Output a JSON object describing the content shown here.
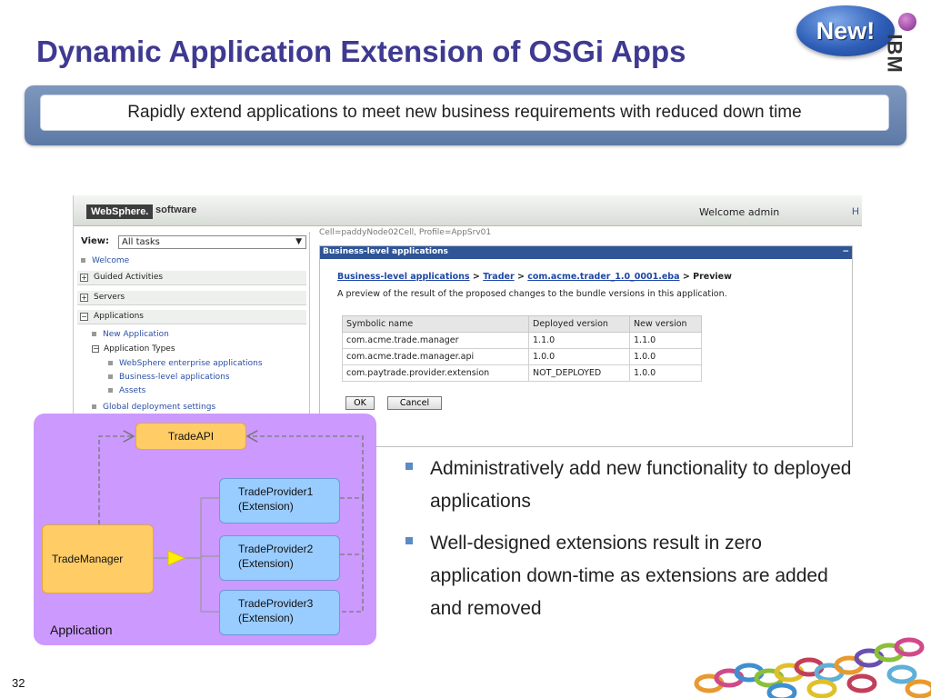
{
  "slide": {
    "title": "Dynamic Application Extension of OSGi Apps",
    "badge": "New!",
    "logo_text": "IBM",
    "banner_text": "Rapidly extend applications to meet new business requirements with reduced down time",
    "page_number": "32"
  },
  "console": {
    "brand": "WebSphere.",
    "brand_suffix": "software",
    "welcome": "Welcome admin",
    "header_trunc": "H",
    "view_label": "View:",
    "view_value": "All tasks",
    "nav": {
      "welcome": "Welcome",
      "guided": "Guided Activities",
      "servers": "Servers",
      "applications": "Applications",
      "new_application": "New Application",
      "application_types": "Application Types",
      "websphere_apps": "WebSphere enterprise applications",
      "bla": "Business-level applications",
      "assets": "Assets",
      "global_deploy": "Global deployment settings"
    },
    "cell_info": "Cell=paddyNode02Cell, Profile=AppSrv01",
    "panel_title": "Business-level applications",
    "panel_min": "−",
    "breadcrumb": {
      "link1": "Business-level applications",
      "link2": "Trader",
      "link3": "com.acme.trader_1.0_0001.eba",
      "sep": ">",
      "current": "Preview"
    },
    "preview_desc": "A preview of the result of the proposed changes to the bundle versions in this application.",
    "table": {
      "headers": [
        "Symbolic name",
        "Deployed version",
        "New version"
      ],
      "rows": [
        [
          "com.acme.trade.manager",
          "1.1.0",
          "1.1.0"
        ],
        [
          "com.acme.trade.manager.api",
          "1.0.0",
          "1.0.0"
        ],
        [
          "com.paytrade.provider.extension",
          "NOT_DEPLOYED",
          "1.0.0"
        ]
      ]
    },
    "ok_label": "OK",
    "cancel_label": "Cancel"
  },
  "diagram": {
    "trade_api": "TradeAPI",
    "trade_manager": "TradeManager",
    "provider1": [
      "TradeProvider1",
      "(Extension)"
    ],
    "provider2": [
      "TradeProvider2",
      "(Extension)"
    ],
    "provider3": [
      "TradeProvider3",
      "(Extension)"
    ],
    "container_label": "Application"
  },
  "bullets": [
    "Administratively add new functionality to deployed applications",
    "Well-designed extensions result in zero application down-time as extensions are added and removed"
  ],
  "colors": {
    "title": "#3e3a91",
    "banner": "#6d89b3",
    "diagram_bg": "#cc99ff",
    "node_orange": "#ffcc66",
    "node_blue": "#99ccff",
    "bullet_marker": "#5b8ac5"
  }
}
